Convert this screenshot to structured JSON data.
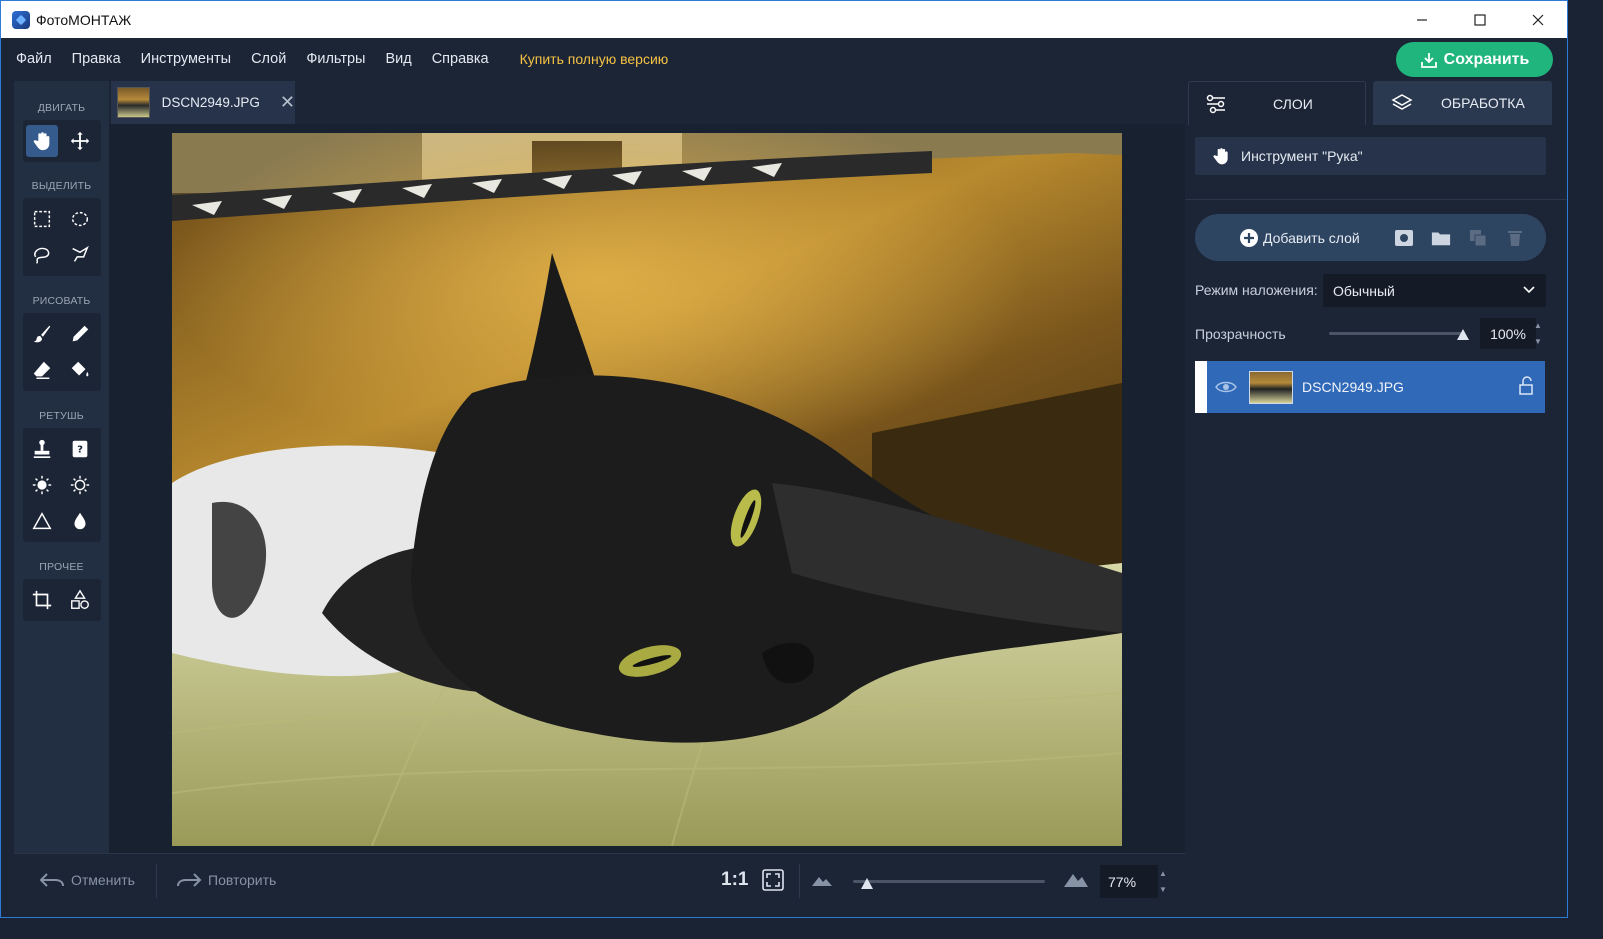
{
  "window": {
    "title": "ФотоМОНТАЖ",
    "controls": [
      "minimize",
      "maximize",
      "close"
    ]
  },
  "menu": {
    "items": [
      "Файл",
      "Правка",
      "Инструменты",
      "Слой",
      "Фильтры",
      "Вид",
      "Справка"
    ],
    "buy_label": "Купить полную версию"
  },
  "save_button": {
    "label": "Сохранить",
    "icon": "download-icon",
    "color": "#1fb57d"
  },
  "toolbar": {
    "sections": [
      {
        "label": "ДВИГАТЬ",
        "tools": [
          "hand-tool",
          "move-tool"
        ]
      },
      {
        "label": "ВЫДЕЛИТЬ",
        "tools": [
          "rect-select-tool",
          "ellipse-select-tool",
          "lasso-tool",
          "polygon-lasso-tool"
        ]
      },
      {
        "label": "РИСОВАТЬ",
        "tools": [
          "brush-tool",
          "pencil-tool",
          "eraser-tool",
          "fill-tool"
        ]
      },
      {
        "label": "РЕТУШЬ",
        "tools": [
          "stamp-tool",
          "patch-tool",
          "dodge-tool",
          "burn-tool",
          "sharpen-tool",
          "blur-tool"
        ]
      },
      {
        "label": "ПРОЧЕЕ",
        "tools": [
          "crop-tool",
          "shapes-tool"
        ]
      }
    ],
    "active_tool": "hand-tool"
  },
  "document": {
    "tab_name": "DSCN2949.JPG"
  },
  "right_panel": {
    "tabs": [
      {
        "label": "СЛОИ",
        "icon": "sliders-icon",
        "active": true
      },
      {
        "label": "ОБРАБОТКА",
        "icon": "layers-icon",
        "active": false
      }
    ],
    "tool_info": "Инструмент \"Рука\"",
    "add_layer_label": "Добавить слой",
    "blend_label": "Режим наложения:",
    "blend_value": "Обычный",
    "opacity_label": "Прозрачность",
    "opacity_value": "100%",
    "opacity_level": 1.0,
    "layers": [
      {
        "name": "DSCN2949.JPG",
        "visible": true,
        "locked": false,
        "selected": true
      }
    ]
  },
  "bottom": {
    "undo_label": "Отменить",
    "redo_label": "Повторить",
    "ratio_label": "1:1",
    "zoom_value": "77%",
    "zoom_level": 0.05
  },
  "colors": {
    "accent": "#2f69b8",
    "save": "#1fb57d",
    "buy": "#f6c244",
    "background": "#1c2536"
  }
}
